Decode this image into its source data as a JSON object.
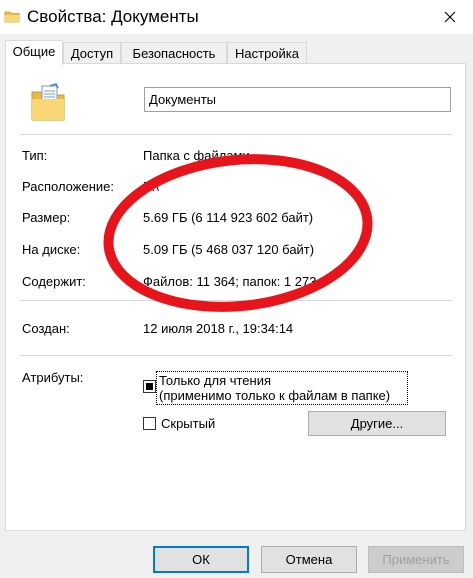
{
  "window": {
    "title": "Свойства: Документы",
    "close_glyph": "✕"
  },
  "tabs": [
    {
      "label": "Общие",
      "active": true
    },
    {
      "label": "Доступ",
      "active": false
    },
    {
      "label": "Безопасность",
      "active": false
    },
    {
      "label": "Настройка",
      "active": false
    }
  ],
  "general": {
    "folder_name": "Документы",
    "rows": {
      "type": {
        "label": "Тип:",
        "value": "Папка с файлами"
      },
      "location": {
        "label": "Расположение:",
        "value": "E:\\"
      },
      "size": {
        "label": "Размер:",
        "value": "5.69 ГБ (6 114 923 602 байт)"
      },
      "disk": {
        "label": "На диске:",
        "value": "5.09 ГБ (5 468 037 120 байт)"
      },
      "contains": {
        "label": "Содержит:",
        "value": "Файлов: 11 364; папок: 1 273"
      },
      "created": {
        "label": "Создан:",
        "value": "12 июля 2018 г., 19:34:14"
      }
    },
    "attributes": {
      "label": "Атрибуты:",
      "readonly_text": "Только для чтения\n(применимо только к файлам в папке)",
      "readonly_line1": "Только для чтения",
      "readonly_line2": "(применимо только к файлам в папке)",
      "readonly_state": "indeterminate",
      "hidden_text": "Скрытый",
      "hidden_checked": false,
      "other_button": "Другие..."
    }
  },
  "buttons": {
    "ok": "ОК",
    "cancel": "Отмена",
    "apply": "Применить",
    "apply_enabled": false
  },
  "colors": {
    "annotation_ellipse": "#e8141b",
    "focus_border": "#0078d7"
  }
}
